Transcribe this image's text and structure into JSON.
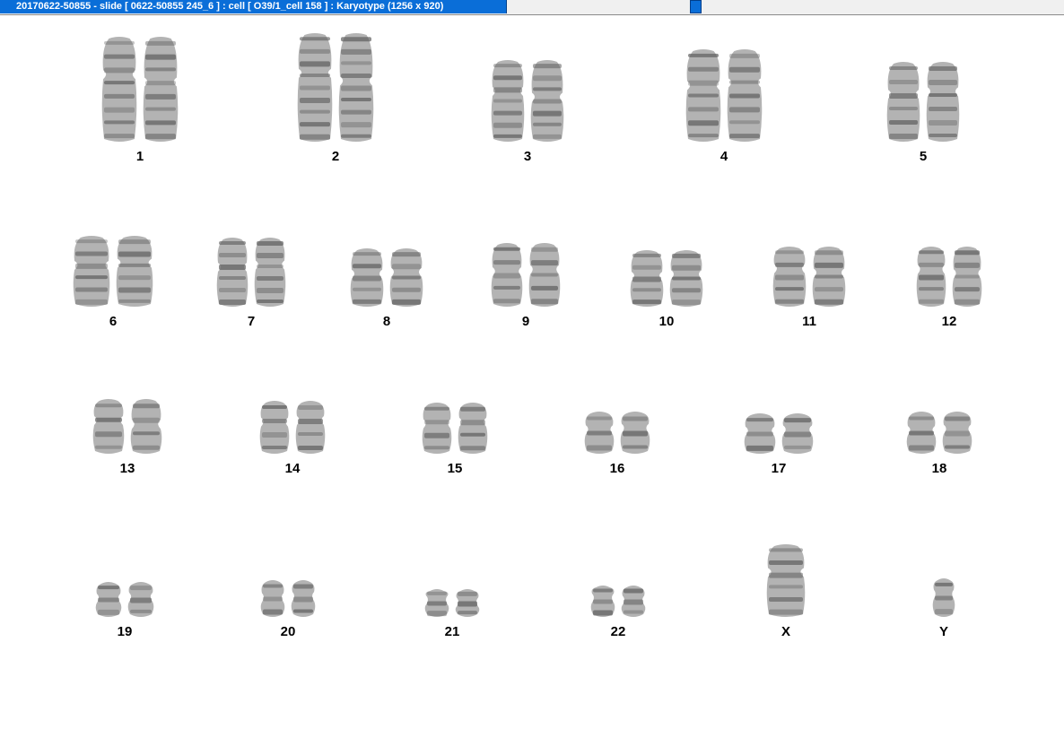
{
  "window": {
    "title": "20170622-50855 - slide [ 0622-50855 245_6 ] : cell [ O39/1_cell 158 ] : Karyotype  (1256 x 920)"
  },
  "chromosomes": [
    "1",
    "2",
    "3",
    "4",
    "5",
    "6",
    "7",
    "8",
    "9",
    "10",
    "11",
    "12",
    "13",
    "14",
    "15",
    "16",
    "17",
    "18",
    "19",
    "20",
    "21",
    "22",
    "X",
    "Y"
  ],
  "colors": {
    "chromosome": "#9a9a9a",
    "chromosome_dark": "#5a5a5a",
    "titlebar": "#0a6ed8"
  }
}
